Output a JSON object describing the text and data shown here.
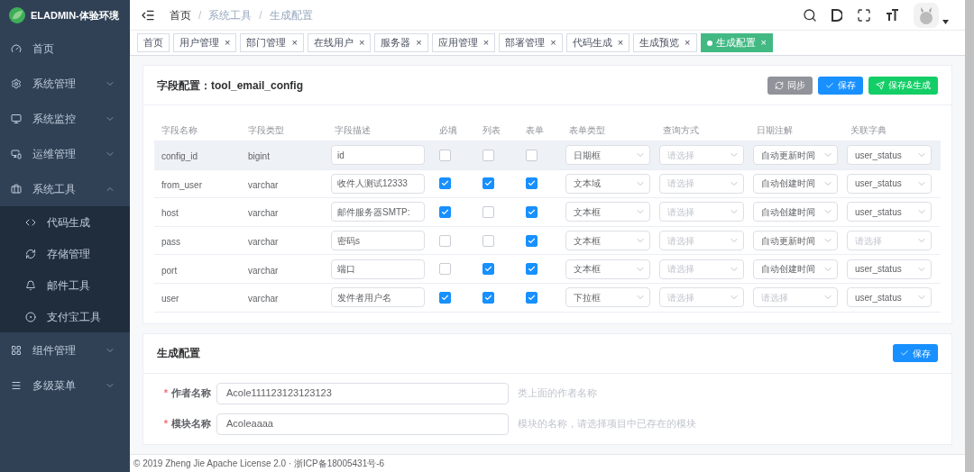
{
  "brand": {
    "title": "ELADMIN-体验环境"
  },
  "sidebar": {
    "items": [
      {
        "label": "首页"
      },
      {
        "label": "系统管理",
        "expanded": false
      },
      {
        "label": "系统监控",
        "expanded": false
      },
      {
        "label": "运维管理",
        "expanded": false
      },
      {
        "label": "系统工具",
        "expanded": true,
        "children": [
          {
            "label": "代码生成"
          },
          {
            "label": "存储管理"
          },
          {
            "label": "邮件工具"
          },
          {
            "label": "支付宝工具"
          }
        ]
      },
      {
        "label": "组件管理",
        "expanded": false
      },
      {
        "label": "多级菜单",
        "expanded": false
      }
    ]
  },
  "breadcrumb": {
    "separator": "/",
    "items": [
      "首页",
      "系统工具",
      "生成配置"
    ]
  },
  "tags": [
    {
      "label": "首页",
      "selected": false
    },
    {
      "label": "用户管理",
      "selected": false,
      "close": "×"
    },
    {
      "label": "部门管理",
      "selected": false,
      "close": "×"
    },
    {
      "label": "在线用户",
      "selected": false,
      "close": "×"
    },
    {
      "label": "服务器",
      "selected": false,
      "close": "×"
    },
    {
      "label": "应用管理",
      "selected": false,
      "close": "×"
    },
    {
      "label": "部署管理",
      "selected": false,
      "close": "×"
    },
    {
      "label": "代码生成",
      "selected": false,
      "close": "×"
    },
    {
      "label": "生成预览",
      "selected": false,
      "close": "×"
    },
    {
      "label": "生成配置",
      "selected": true,
      "close": "×"
    }
  ],
  "field_config": {
    "title": "字段配置：tool_email_config",
    "buttons": [
      {
        "label": "同步",
        "kind": "sync"
      },
      {
        "label": "保存",
        "kind": "save"
      },
      {
        "label": "保存&生成",
        "kind": "generate"
      }
    ],
    "columns": [
      "字段名称",
      "字段类型",
      "字段描述",
      "必填",
      "列表",
      "表单",
      "表单类型",
      "查询方式",
      "日期注解",
      "关联字典"
    ],
    "rows": [
      {
        "name": "config_id",
        "db_type": "bigint",
        "desc": "id",
        "required": false,
        "list": false,
        "form": false,
        "form_type": {
          "value": "日期框"
        },
        "query": {
          "placeholder": "请选择"
        },
        "date": {
          "value": "自动更新时间"
        },
        "dict": {
          "value": "user_status"
        },
        "selected": true
      },
      {
        "name": "from_user",
        "db_type": "varchar",
        "desc": "收件人测试12333",
        "required": true,
        "list": true,
        "form": true,
        "form_type": {
          "value": "文本域"
        },
        "query": {
          "placeholder": "请选择"
        },
        "date": {
          "value": "自动创建时间"
        },
        "dict": {
          "value": "user_status"
        },
        "selected": false
      },
      {
        "name": "host",
        "db_type": "varchar",
        "desc": "邮件服务器SMTP:",
        "required": true,
        "list": false,
        "form": true,
        "form_type": {
          "value": "文本框"
        },
        "query": {
          "placeholder": "请选择"
        },
        "date": {
          "value": "自动创建时间"
        },
        "dict": {
          "value": "user_status"
        },
        "selected": false
      },
      {
        "name": "pass",
        "db_type": "varchar",
        "desc": "密码s",
        "required": false,
        "list": false,
        "form": true,
        "form_type": {
          "value": "文本框"
        },
        "query": {
          "placeholder": "请选择"
        },
        "date": {
          "value": "自动更新时间"
        },
        "dict": {
          "placeholder": "请选择"
        },
        "selected": false
      },
      {
        "name": "port",
        "db_type": "varchar",
        "desc": "端口",
        "required": false,
        "list": true,
        "form": true,
        "form_type": {
          "value": "文本框"
        },
        "query": {
          "placeholder": "请选择"
        },
        "date": {
          "value": "自动创建时间"
        },
        "dict": {
          "value": "user_status"
        },
        "selected": false
      },
      {
        "name": "user",
        "db_type": "varchar",
        "desc": "发件者用户名",
        "required": true,
        "list": true,
        "form": true,
        "form_type": {
          "value": "下拉框"
        },
        "query": {
          "placeholder": "请选择"
        },
        "date": {
          "placeholder": "请选择"
        },
        "dict": {
          "value": "user_status"
        },
        "selected": false
      }
    ]
  },
  "gen_config": {
    "title": "生成配置",
    "save_button": "保存",
    "fields": [
      {
        "marker": "*",
        "label": "作者名称",
        "value": "Acole111123123123123",
        "hint": "类上面的作者名称"
      },
      {
        "marker": "*",
        "label": "模块名称",
        "value": "Acoleaaaa",
        "hint": "模块的名称，请选择项目中已存在的模块"
      }
    ]
  },
  "footer": "© 2019 Zheng Jie Apache License 2.0 · 浙ICP备18005431号-6"
}
